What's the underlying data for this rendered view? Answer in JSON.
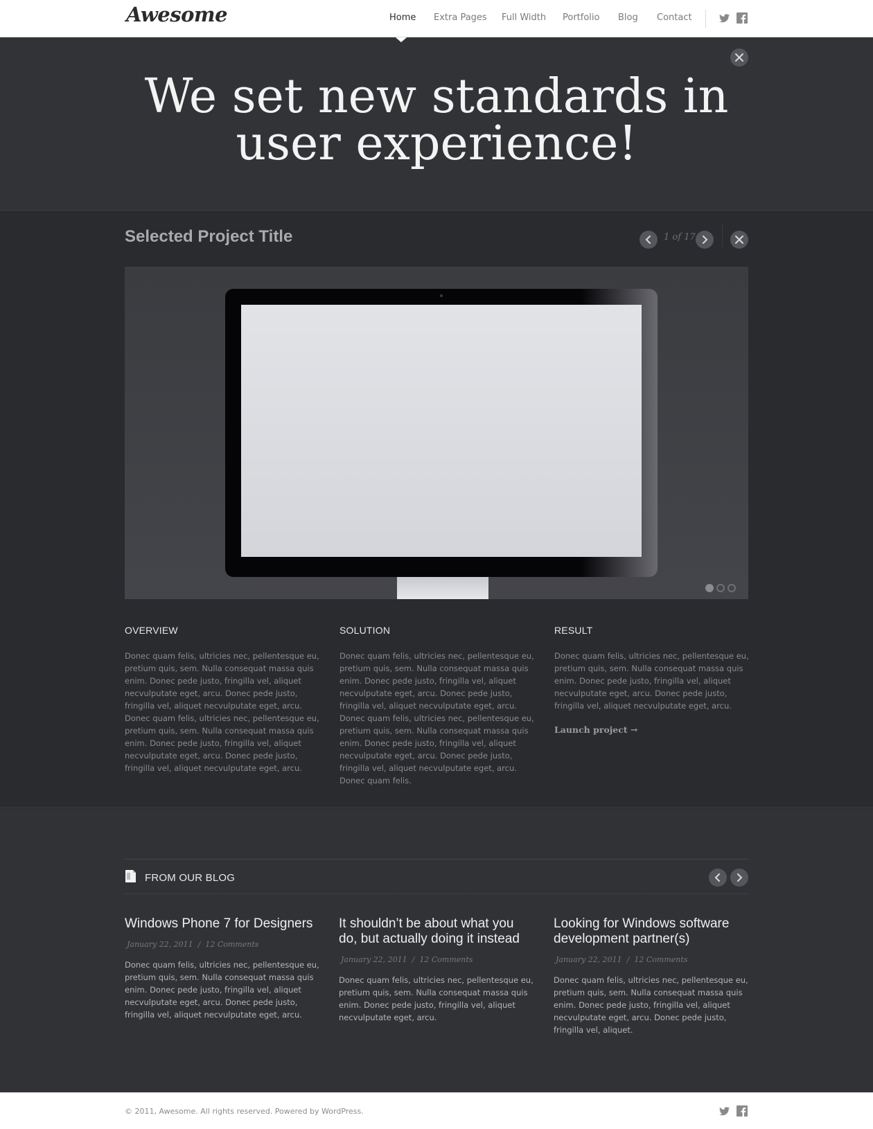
{
  "header": {
    "logo": "Awesome",
    "nav": [
      "Home",
      "Extra Pages",
      "Full Width",
      "Portfolio",
      "Blog",
      "Contact"
    ],
    "active_nav": "Home",
    "social": [
      "twitter-icon",
      "facebook-icon"
    ]
  },
  "hero": {
    "title_line1": "We set new standards in",
    "title_line2": "user experience!",
    "close_icon": "close-icon"
  },
  "project": {
    "title": "Selected Project Title",
    "pager_current": "1",
    "pager_of": "of",
    "pager_total": "17",
    "slides": 3,
    "active_slide": 1,
    "columns": [
      {
        "heading": "OVERVIEW",
        "text": "Donec quam felis, ultricies nec, pellentesque eu, pretium quis, sem. Nulla consequat massa quis enim. Donec pede justo, fringilla vel, aliquet necvulputate eget, arcu. Donec pede justo, fringilla vel, aliquet necvulputate eget, arcu. Donec quam felis, ultricies nec, pellentesque eu, pretium quis, sem. Nulla consequat massa quis enim. Donec pede justo, fringilla vel, aliquet necvulputate eget, arcu. Donec pede justo, fringilla vel, aliquet necvulputate eget, arcu."
      },
      {
        "heading": "SOLUTION",
        "text": "Donec quam felis, ultricies nec, pellentesque eu, pretium quis, sem. Nulla consequat massa quis enim. Donec pede justo, fringilla vel, aliquet necvulputate eget, arcu. Donec pede justo, fringilla vel, aliquet necvulputate eget, arcu. Donec quam felis, ultricies nec, pellentesque eu, pretium quis, sem. Nulla consequat massa quis enim. Donec pede justo, fringilla vel, aliquet necvulputate eget, arcu. Donec pede justo, fringilla vel, aliquet necvulputate eget, arcu. Donec quam felis."
      },
      {
        "heading": "RESULT",
        "text": "Donec quam felis, ultricies nec, pellentesque eu, pretium quis, sem. Nulla consequat massa quis enim. Donec pede justo, fringilla vel, aliquet necvulputate eget, arcu. Donec pede justo, fringilla vel, aliquet necvulputate eget, arcu.",
        "link": "Launch project →"
      }
    ]
  },
  "blog": {
    "title": "FROM OUR BLOG",
    "posts": [
      {
        "title": "Windows Phone 7 for Designers",
        "date": "January 22, 2011",
        "sep": "/",
        "comments": "12 Comments",
        "text": "Donec quam felis, ultricies nec, pellentesque eu, pretium quis, sem. Nulla consequat massa quis enim. Donec pede justo, fringilla vel, aliquet necvulputate eget, arcu. Donec pede justo, fringilla vel, aliquet necvulputate eget, arcu."
      },
      {
        "title": "It shouldn’t be about what you do, but actually doing it instead",
        "date": "January 22, 2011",
        "sep": "/",
        "comments": "12 Comments",
        "text": "Donec quam felis, ultricies nec, pellentesque eu, pretium quis, sem. Nulla consequat massa quis enim. Donec pede justo, fringilla vel, aliquet necvulputate eget, arcu."
      },
      {
        "title": "Looking for Windows software development partner(s)",
        "date": "January 22, 2011",
        "sep": "/",
        "comments": "12 Comments",
        "text": "Donec quam felis, ultricies nec, pellentesque eu, pretium quis, sem. Nulla consequat massa quis enim. Donec pede justo, fringilla vel, aliquet necvulputate eget, arcu. Donec pede justo, fringilla vel, aliquet."
      }
    ]
  },
  "footer": {
    "copyright": "© 2011, Awesome. All rights reserved. Powered by WordPress."
  },
  "colors": {
    "header_bg": "#ffffff",
    "hero_bg": "#323337",
    "project_bg": "#2a2b2f",
    "blog_bg": "#313236",
    "button_bg": "#55565b"
  }
}
